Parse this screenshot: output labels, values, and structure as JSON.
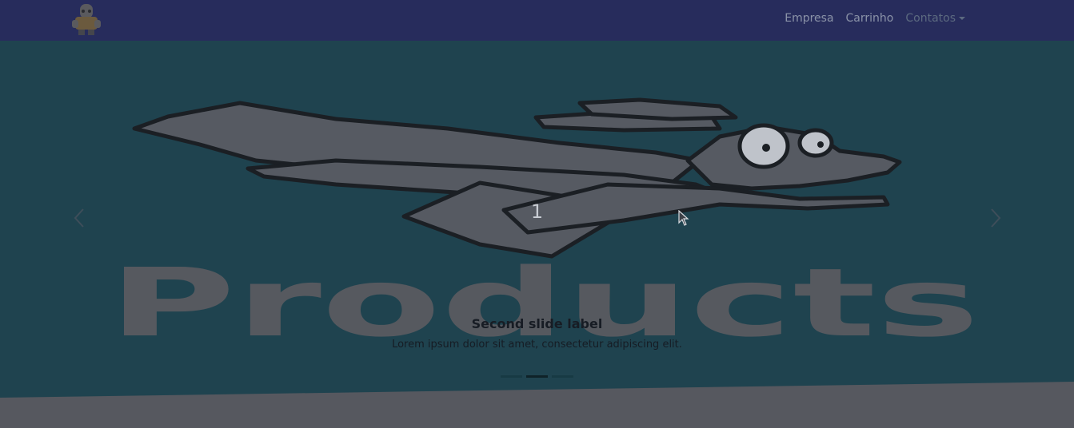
{
  "navbar": {
    "links": [
      {
        "label": "Empresa"
      },
      {
        "label": "Carrinho"
      },
      {
        "label": "Contatos"
      }
    ]
  },
  "carousel": {
    "slide_number": "1",
    "slide_image_text": "Products",
    "caption_title": "Second slide label",
    "caption_text": "Lorem ipsum dolor sit amet, consectetur adipiscing elit.",
    "indicators": [
      {
        "active": false
      },
      {
        "active": true
      },
      {
        "active": false
      }
    ],
    "prev_icon": "chevron-left-icon",
    "next_icon": "chevron-right-icon"
  },
  "colors": {
    "navbar_bg": "#272c5c",
    "carousel_bg": "#1f434f",
    "overlay_page_bg": "#56585f",
    "art_fill": "#565a62"
  }
}
